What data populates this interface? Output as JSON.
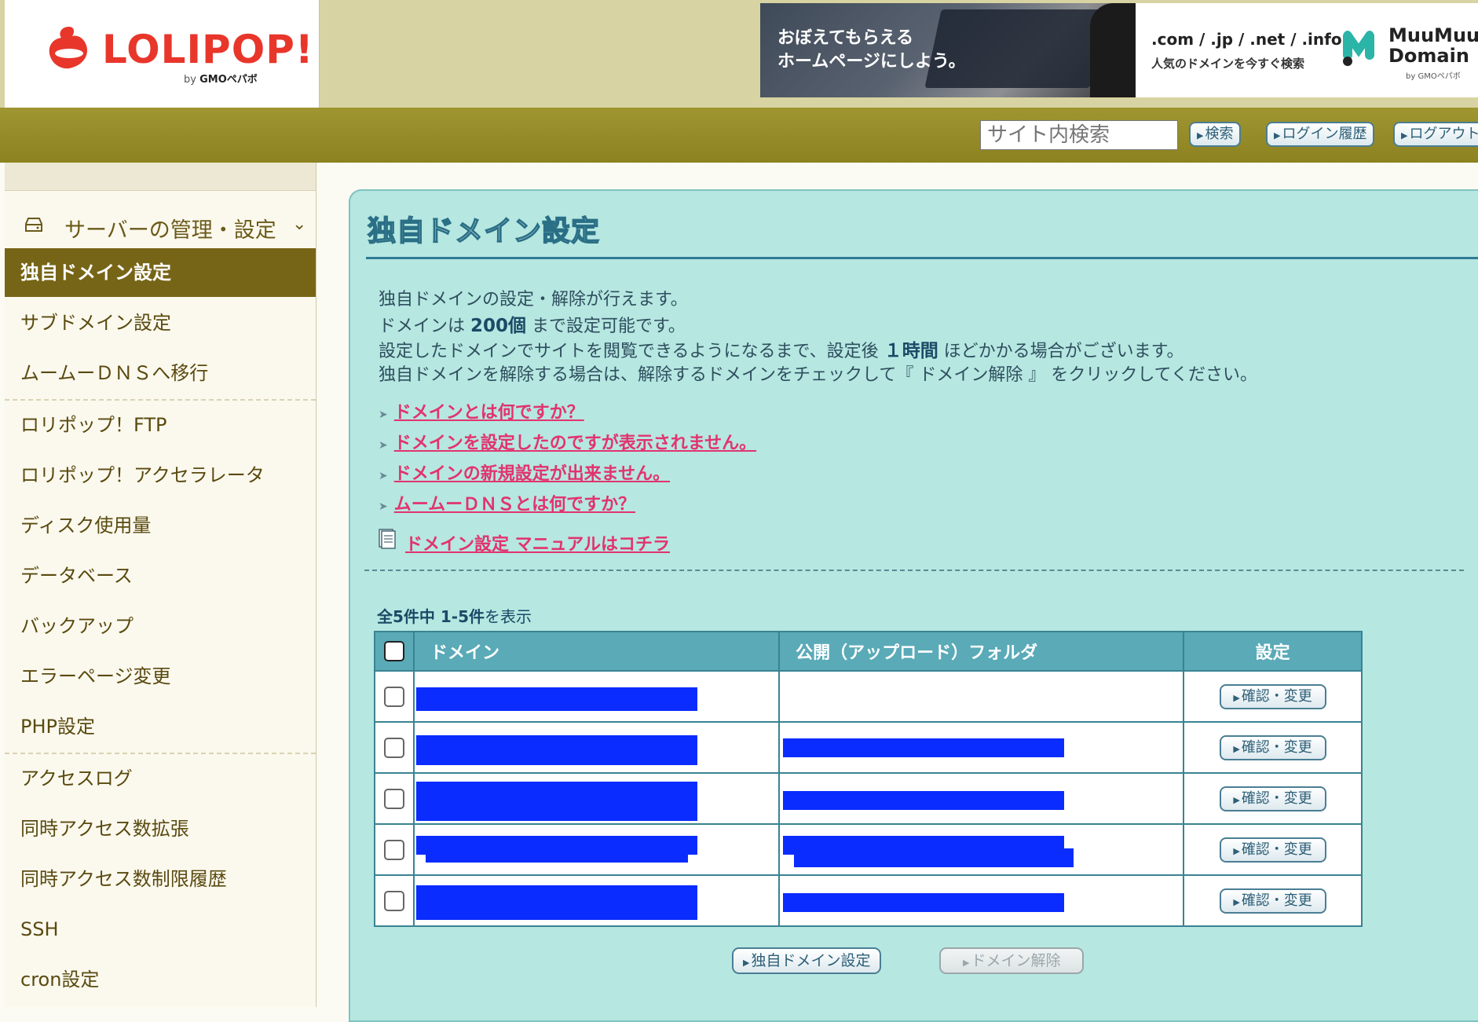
{
  "header": {
    "logo_text": "LOLIPOP!",
    "logo_sub_by": "by",
    "logo_sub_brand": "GMOペパボ",
    "banner": {
      "copy_line1": "おぼえてもらえる",
      "copy_line2": "ホームページにしよう。",
      "tld_line": ".com / .jp / .net / .info",
      "tld_sub": "人気のドメインを今すぐ検索",
      "brand_line1": "MuuMuu",
      "brand_line2": "Domain",
      "brand_by": "by GMOペパボ"
    }
  },
  "toolbar": {
    "search_placeholder": "サイト内検索",
    "search_button": "検索",
    "login_history_button": "ログイン履歴",
    "logout_button": "ログアウト"
  },
  "sidebar": {
    "section_title": "サーバーの管理・設定",
    "items": [
      {
        "label": "独自ドメイン設定",
        "active": true
      },
      {
        "label": "サブドメイン設定"
      },
      {
        "label": "ムームーＤＮＳへ移行"
      },
      {
        "label": "ロリポップ！FTP"
      },
      {
        "label": "ロリポップ！アクセラレータ"
      },
      {
        "label": "ディスク使用量"
      },
      {
        "label": "データベース"
      },
      {
        "label": "バックアップ"
      },
      {
        "label": "エラーページ変更"
      },
      {
        "label": "PHP設定"
      },
      {
        "label": "アクセスログ"
      },
      {
        "label": "同時アクセス数拡張"
      },
      {
        "label": "同時アクセス数制限履歴"
      },
      {
        "label": "SSH"
      },
      {
        "label": "cron設定"
      }
    ]
  },
  "main": {
    "title": "独自ドメイン設定",
    "desc1": "独自ドメインの設定・解除が行えます。",
    "desc2_a": "ドメインは ",
    "desc2_b": "200個",
    "desc2_c": " まで設定可能です。",
    "desc3_a": "設定したドメインでサイトを閲覧できるようになるまで、設定後 ",
    "desc3_b": "１時間",
    "desc3_c": " ほどかかる場合がございます。",
    "desc4": "独自ドメインを解除する場合は、解除するドメインをチェックして『 ドメイン解除 』 をクリックしてください。",
    "help_links": [
      "ドメインとは何ですか？",
      "ドメインを設定したのですが表示されません。",
      "ドメインの新規設定が出来ません。",
      "ムームーＤＮＳとは何ですか？"
    ],
    "manual_link": "ドメイン設定 マニュアルはコチラ",
    "count_a": "全5件中 1-5件",
    "count_b": "を表示",
    "table": {
      "col_domain": "ドメイン",
      "col_folder": "公開（アップロード）フォルダ",
      "col_setting": "設定",
      "row_button": "確認・変更"
    },
    "bottom_buttons": {
      "add": "独自ドメイン設定",
      "remove": "ドメイン解除"
    }
  },
  "colors": {
    "accent_olive": "#776517",
    "panel_bg": "#b6e7e1",
    "link_pink": "#e2336e",
    "redaction_blue": "#0a2cff"
  }
}
